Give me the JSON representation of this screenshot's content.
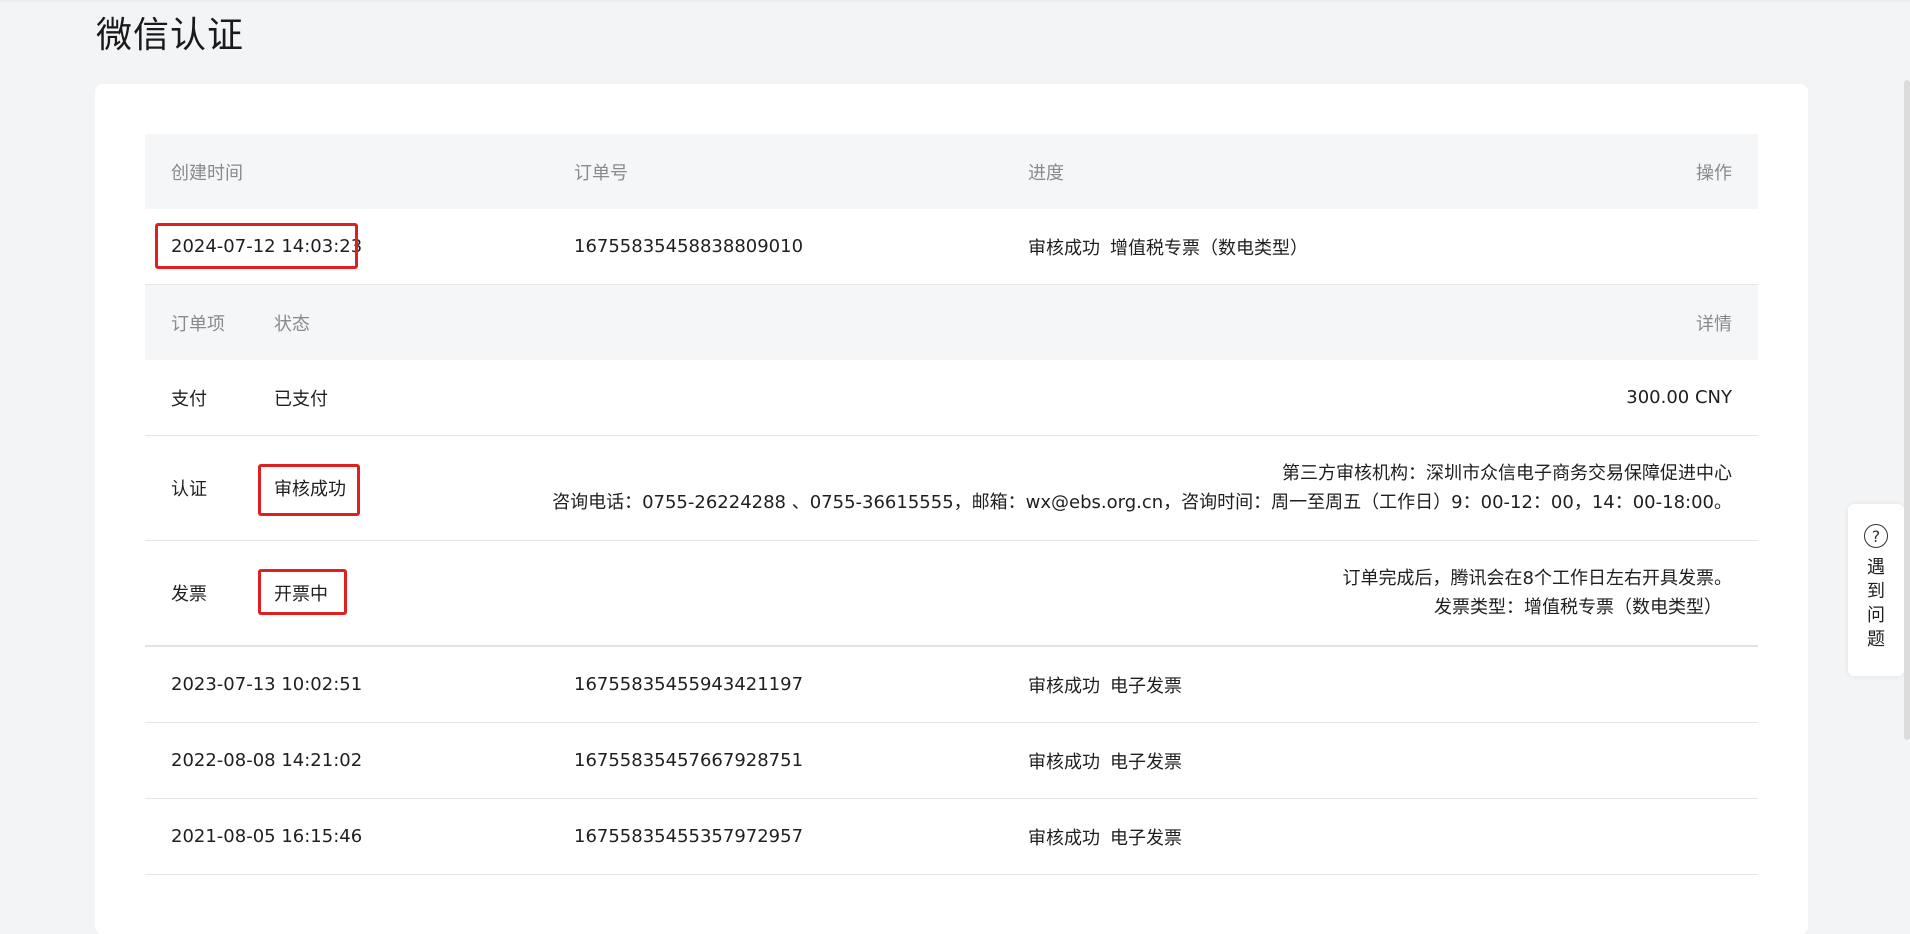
{
  "page": {
    "title": "微信认证"
  },
  "table": {
    "headers": {
      "created": "创建时间",
      "order_no": "订单号",
      "progress": "进度",
      "action": "操作"
    },
    "orders": [
      {
        "created": "2024-07-12 14:03:23",
        "order_no": "16755835458838809010",
        "progress_status": "审核成功",
        "progress_type": "增值税专票（数电类型）",
        "expanded": true,
        "sub_headers": {
          "item": "订单项",
          "status": "状态",
          "details": "详情"
        },
        "sub_items": [
          {
            "item": "支付",
            "status": "已支付",
            "details": [
              "300.00 CNY"
            ]
          },
          {
            "item": "认证",
            "status": "审核成功",
            "details": [
              "第三方审核机构：深圳市众信电子商务交易保障促进中心",
              "咨询电话：0755-26224288 、0755-36615555，邮箱：wx@ebs.org.cn，咨询时间：周一至周五（工作日）9：00-12：00，14：00-18:00。"
            ]
          },
          {
            "item": "发票",
            "status": "开票中",
            "details": [
              "订单完成后，腾讯会在8个工作日左右开具发票。",
              "发票类型：增值税专票（数电类型）"
            ]
          }
        ]
      },
      {
        "created": "2023-07-13 10:02:51",
        "order_no": "16755835455943421197",
        "progress_status": "审核成功",
        "progress_type": "电子发票"
      },
      {
        "created": "2022-08-08 14:21:02",
        "order_no": "16755835457667928751",
        "progress_status": "审核成功",
        "progress_type": "电子发票"
      },
      {
        "created": "2021-08-05 16:15:46",
        "order_no": "16755835455357972957",
        "progress_status": "审核成功",
        "progress_type": "电子发票"
      }
    ]
  },
  "help": {
    "icon": "question-circle-icon",
    "label": "遇到问题",
    "glyph": "?"
  },
  "colors": {
    "highlight": "#e02020",
    "header_bg": "#f5f6f8",
    "page_bg": "#f3f4f6"
  }
}
